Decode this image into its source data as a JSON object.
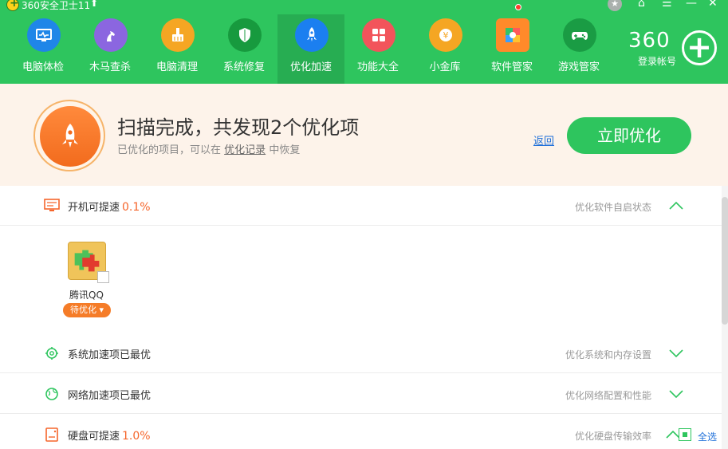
{
  "titlebar": {
    "app_title": "360安全卫士11"
  },
  "nav": {
    "items": [
      {
        "label": "电脑体检",
        "icon": "pc-checkup-icon",
        "color": "#1f86e8"
      },
      {
        "label": "木马查杀",
        "icon": "horse-icon",
        "color": "#8b66e0"
      },
      {
        "label": "电脑清理",
        "icon": "broom-icon",
        "color": "#f5a623"
      },
      {
        "label": "系统修复",
        "icon": "shield-icon",
        "color": "#179a3e"
      },
      {
        "label": "优化加速",
        "icon": "rocket-icon",
        "color": "#1b7ff0"
      },
      {
        "label": "功能大全",
        "icon": "grid-icon",
        "color": "#f2545b"
      },
      {
        "label": "小金库",
        "icon": "coin-icon",
        "color": "#f5a623"
      },
      {
        "label": "软件管家",
        "icon": "software-icon",
        "color": "#ff8a2a"
      },
      {
        "label": "游戏管家",
        "icon": "gamepad-icon",
        "color": "#1a9c44"
      }
    ]
  },
  "account": {
    "brand": "360",
    "login_label": "登录帐号"
  },
  "result": {
    "title": "扫描完成，共发现2个优化项",
    "subtitle_prefix": "已优化的项目，可以在",
    "subtitle_link": "优化记录",
    "subtitle_suffix": "中恢复",
    "back_link": "返回",
    "optimize_button": "立即优化"
  },
  "sections": [
    {
      "title": "开机可提速",
      "percent": "0.1%",
      "hint": "优化软件自启状态",
      "icon": "monitor-icon",
      "expanded": true
    },
    {
      "title": "系统加速项已最优",
      "percent": "",
      "hint": "优化系统和内存设置",
      "icon": "gear-icon",
      "expanded": false
    },
    {
      "title": "网络加速项已最优",
      "percent": "",
      "hint": "优化网络配置和性能",
      "icon": "globe-icon",
      "expanded": false
    },
    {
      "title": "硬盘可提速",
      "percent": "1.0%",
      "hint": "优化硬盘传输效率",
      "icon": "disk-icon",
      "expanded": true
    }
  ],
  "startup_apps": [
    {
      "name": "腾讯QQ",
      "status": "待优化"
    }
  ],
  "footer": {
    "select_all": "全选"
  },
  "colors": {
    "header_green": "#2ec55e",
    "accent_orange": "#f5662c",
    "link_blue": "#1e6fd9"
  }
}
